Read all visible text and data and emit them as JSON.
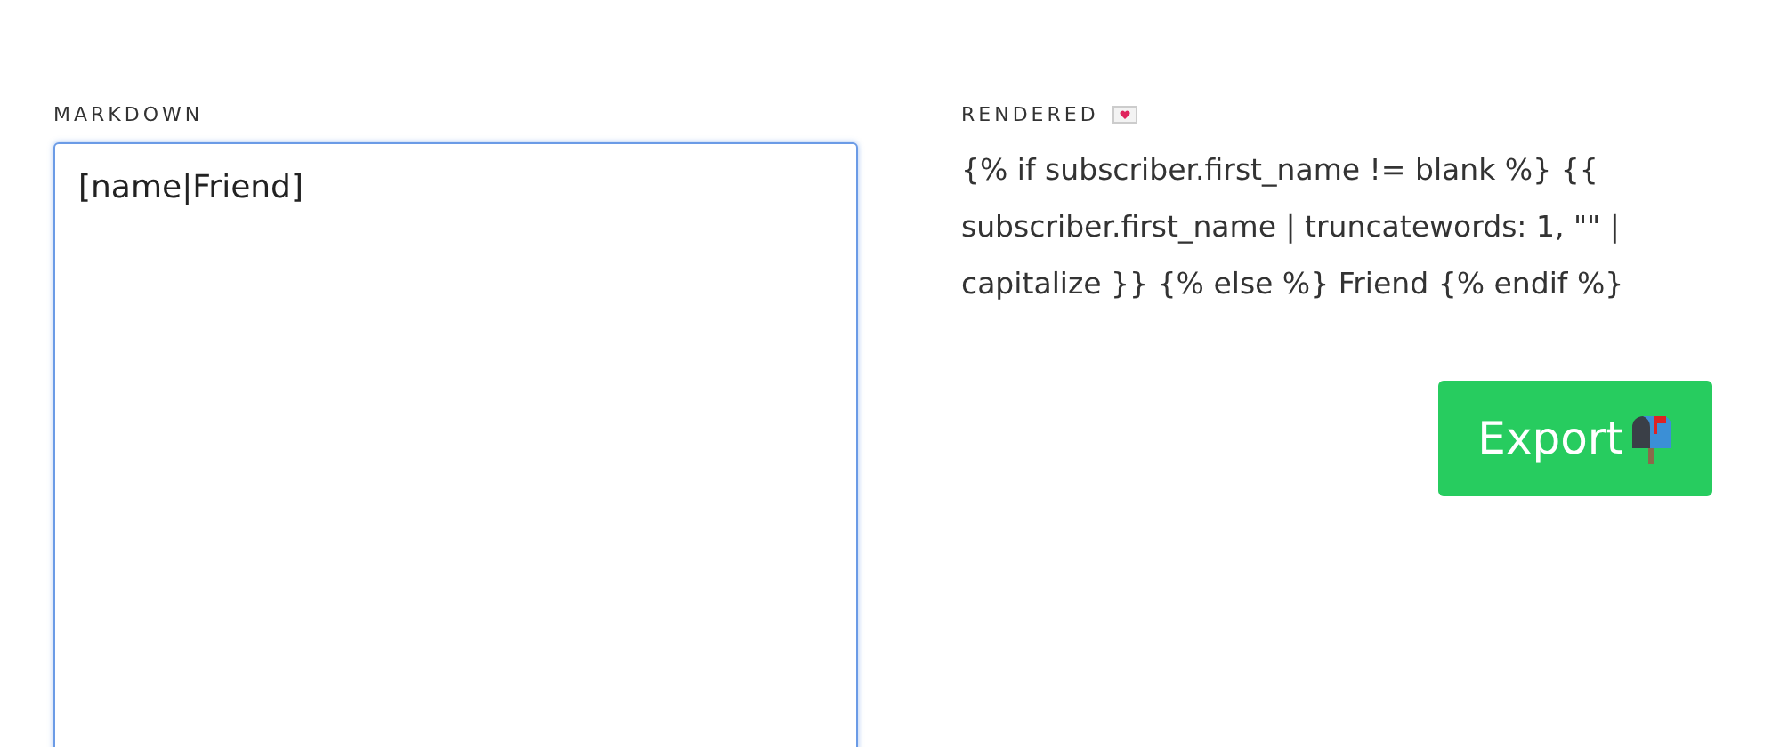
{
  "markdown": {
    "label": "MARKDOWN",
    "value": "[name|Friend]",
    "focused": true
  },
  "rendered": {
    "label": "RENDERED",
    "text": "{% if subscriber.first_name != blank %} {{ subscriber.first_name | truncatewords: 1, \"\" | capitalize }} {% else %} Friend {% endif %}"
  },
  "export_button": {
    "label": "Export"
  }
}
